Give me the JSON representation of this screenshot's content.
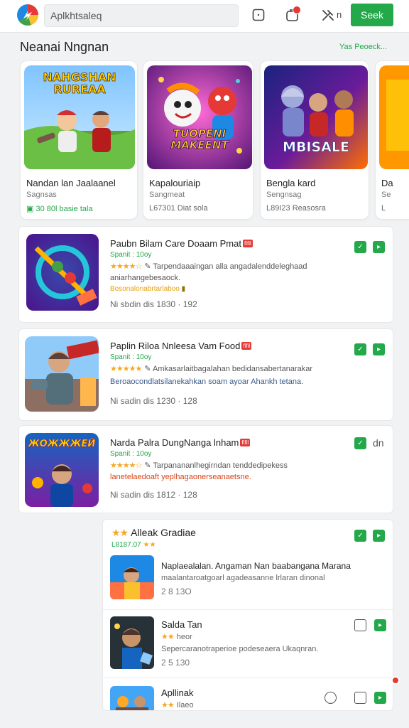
{
  "header": {
    "search_value": "Aplkhtsaleq",
    "seek_label": "Seek",
    "notification_icon": "bell-icon",
    "settings_icon": "tools-icon",
    "settings_label": "n"
  },
  "featured": {
    "title": "Neanai Nngnan",
    "link": "Yas Peoeck...",
    "cards": [
      {
        "image_text": "NAHGSHAN RUREAA",
        "title": "Nandan lan Jaalaanel",
        "subtitle": "Sagnsas",
        "meta": "30 80l basie tala"
      },
      {
        "image_text": "TUOPENI MAKEENT",
        "title": "Kapalouriaip",
        "subtitle": "Sangmeat",
        "meta": "L67301 Diat sola"
      },
      {
        "image_text": "MBISALE",
        "title": "Bengla kard",
        "subtitle": "Sengnsag",
        "meta": "L89I23 Reasosra"
      },
      {
        "title": "Da",
        "subtitle": "Se",
        "meta": "L"
      }
    ]
  },
  "list": [
    {
      "title": "Paubn Bilam Care Doaam Pmat",
      "tag": "fifil",
      "subtitle": "Spanit : 10oy",
      "rating": "★★★★☆",
      "desc": "Tarpendaaaingan alla angadalenddeleghaad",
      "desc2": "aniarhangebesaock.",
      "desc3": "Bosonalonabrtarlaboo",
      "meta": "Ni sbdin dis 1830 · 192"
    },
    {
      "title": "Paplin Riloa Nnleesa Vam Food",
      "tag": "fifil",
      "subtitle": "Spanit : 10oy",
      "rating": "★★★★★",
      "desc": "Amkasarlaitbagalahan bedidansabertanarakar",
      "desc2": "Beroaocondlatsilanekahkan soam ayoar Ahankh tetana.",
      "meta": "Ni sadin dis 1230 · 128"
    },
    {
      "title": "Narda Palra DungNanga lnham",
      "tag": "fifil",
      "subtitle": "Spanit : 10oy",
      "rating": "★★★★☆",
      "desc": "Tarpanananlhegirndan tenddedipekess",
      "desc2": "lanetelaedoaft yeplhagaonerseanaetsne.",
      "meta": "Ni sadin dis 1812 · 128",
      "side_text": "dn"
    }
  ],
  "panel": {
    "title": "Alleak Gradiae",
    "subtitle": "L8187.07",
    "items": [
      {
        "title": "Naplaealalan. Angaman Nan baabangana Marana",
        "desc": "maalantaroatgoarl agadeasanne lrlaran dinonal",
        "meta": "2 8 13O"
      },
      {
        "title": "Salda Tan",
        "rating": "★★",
        "rating_text": "heor",
        "desc": "Sepercaranotraperioe podeseaera Ukaqnran.",
        "meta": "2 5 130"
      },
      {
        "title": "Apllinak",
        "rating": "★★",
        "rating_text": "Ilaeo"
      }
    ]
  },
  "colors": {
    "accent": "#23a84a",
    "badge": "#e53935",
    "star": "#f5a623"
  }
}
